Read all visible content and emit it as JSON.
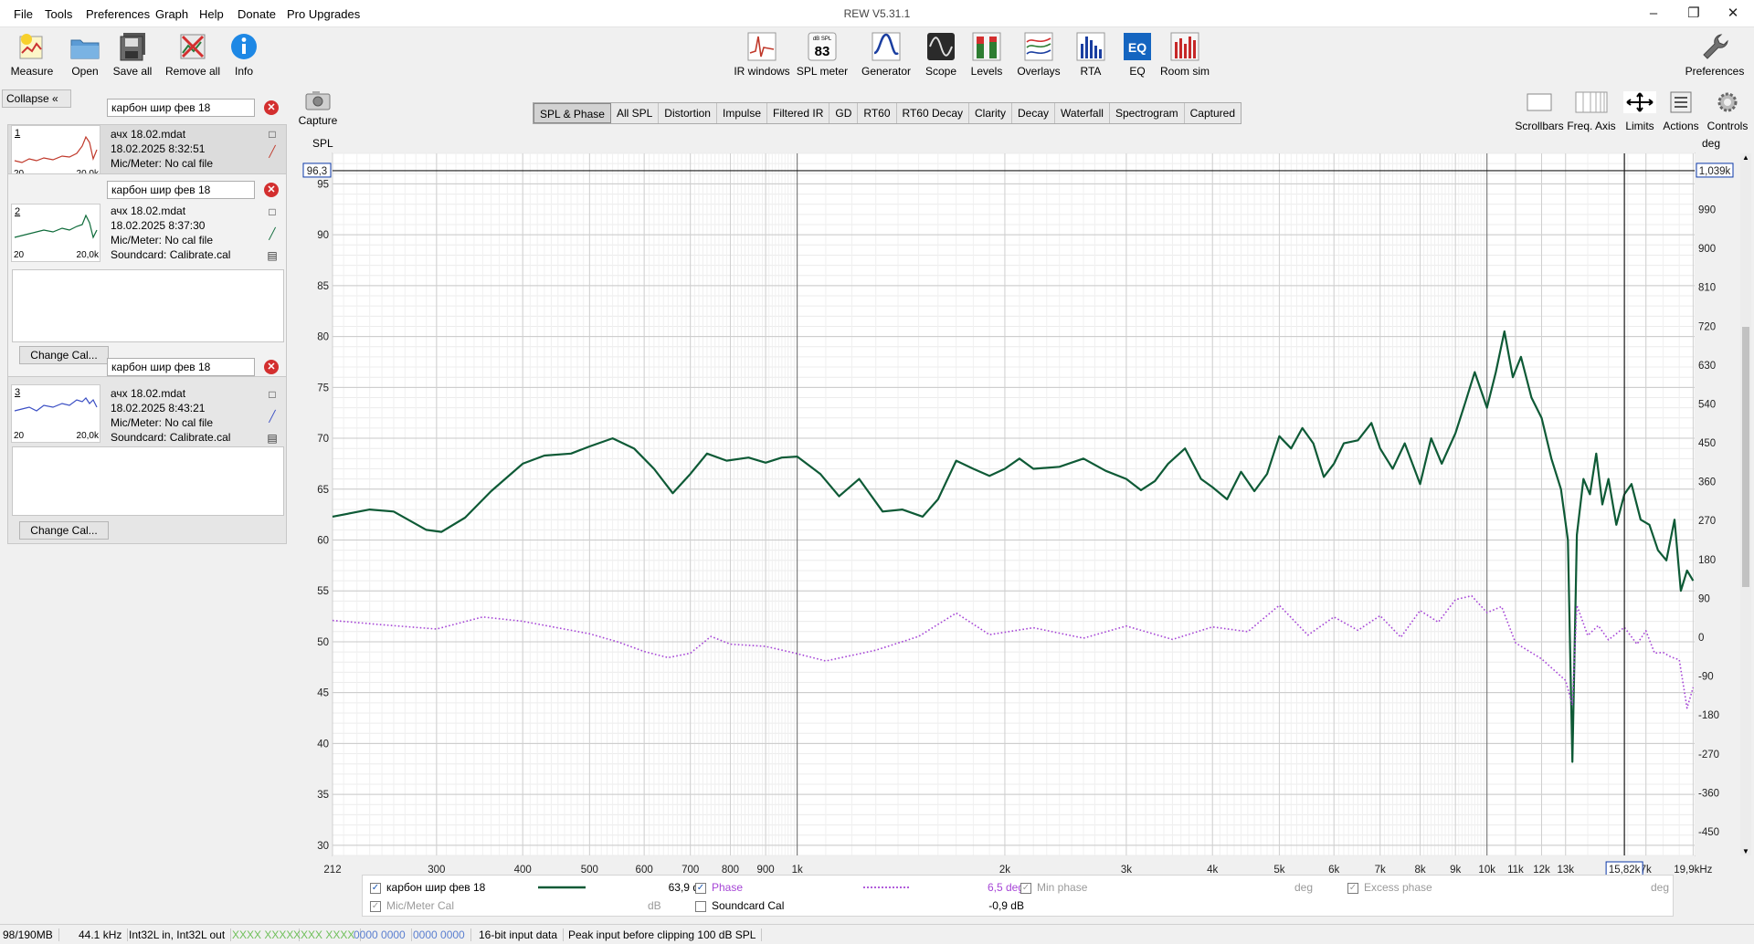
{
  "window": {
    "title": "REW V5.31.1"
  },
  "menu": [
    "File",
    "Tools",
    "Preferences",
    "Graph",
    "Help",
    "Donate",
    "Pro Upgrades"
  ],
  "toolbar_left": [
    "Measure",
    "Open",
    "Save all",
    "Remove all",
    "Info"
  ],
  "toolbar_center": [
    "IR windows",
    "SPL meter",
    "Generator",
    "Scope",
    "Levels",
    "Overlays",
    "RTA",
    "EQ",
    "Room sim"
  ],
  "toolbar_right": {
    "preferences": "Preferences"
  },
  "spl_meter_icon": {
    "unit": "dB SPL",
    "value": "83"
  },
  "left_panel": {
    "collapse_label": "Collapse",
    "change_cal_label": "Change Cal...",
    "measurements": [
      {
        "index": "1",
        "name": "карбон шир фев 18",
        "file": "ачх 18.02.mdat",
        "date": "18.02.2025 8:32:51",
        "mic": "Mic/Meter: No cal file",
        "thumb_lo": "20",
        "thumb_hi": "20,0k",
        "color": "#c0392b"
      },
      {
        "index": "2",
        "name": "карбон шир фев 18",
        "file": "ачх 18.02.mdat",
        "date": "18.02.2025 8:37:30",
        "mic": "Mic/Meter: No cal file",
        "soundcard": "Soundcard: Calibrate.cal",
        "thumb_lo": "20",
        "thumb_hi": "20,0k",
        "color": "#0e6b3a"
      },
      {
        "index": "3",
        "name": "карбон шир фев 18",
        "file": "ачх 18.02.mdat",
        "date": "18.02.2025 8:43:21",
        "mic": "Mic/Meter: No cal file",
        "soundcard": "Soundcard: Calibrate.cal",
        "thumb_lo": "20",
        "thumb_hi": "20,0k",
        "color": "#3b4fc4"
      }
    ]
  },
  "graph": {
    "capture_label": "Capture",
    "tabs": [
      "SPL & Phase",
      "All SPL",
      "Distortion",
      "Impulse",
      "Filtered IR",
      "GD",
      "RT60",
      "RT60 Decay",
      "Clarity",
      "Decay",
      "Waterfall",
      "Spectrogram",
      "Captured"
    ],
    "active_tab": "SPL & Phase",
    "right_controls": [
      "Scrollbars",
      "Freq. Axis",
      "Limits",
      "Actions",
      "Controls"
    ],
    "left_axis_title": "SPL",
    "right_axis_title": "deg",
    "cursor_spl": "96,3",
    "cursor_phase": "1,039k",
    "cursor_freq": "15,82k"
  },
  "chart_data": {
    "type": "line",
    "xlabel": "",
    "ylabel": "SPL",
    "x_scale": "log",
    "xlim": [
      212,
      20000
    ],
    "ylim": [
      29,
      98
    ],
    "y2lim": [
      -505,
      1120
    ],
    "y2label": "deg",
    "x_ticks": [
      212,
      300,
      400,
      500,
      600,
      700,
      800,
      900,
      1000,
      2000,
      3000,
      4000,
      5000,
      6000,
      7000,
      8000,
      9000,
      10000,
      11000,
      12000,
      13000,
      15820,
      17000,
      19900
    ],
    "x_tick_labels": [
      "212",
      "300",
      "400",
      "500",
      "600",
      "700",
      "800",
      "900",
      "1k",
      "2k",
      "3k",
      "4k",
      "5k",
      "6k",
      "7k",
      "8k",
      "9k",
      "10k",
      "11k",
      "12k",
      "13k",
      "15,82k",
      "7k",
      "19,9kHz"
    ],
    "y_ticks": [
      30,
      35,
      40,
      45,
      50,
      55,
      60,
      65,
      70,
      75,
      80,
      85,
      90,
      95
    ],
    "y2_ticks": [
      -450,
      -360,
      -270,
      -180,
      -90,
      0,
      90,
      180,
      270,
      360,
      450,
      540,
      630,
      720,
      810,
      900,
      990,
      1080
    ],
    "y2_tick_labels": [
      "-450",
      "-360",
      "-270",
      "-180",
      "-90",
      "0",
      "90",
      "180",
      "270",
      "360",
      "450",
      "540",
      "630",
      "720",
      "810",
      "900",
      "990",
      "1,08k"
    ],
    "grid": true,
    "cursor": {
      "x": 15820,
      "y": 96.3
    },
    "series": [
      {
        "name": "карбон шир фев 18",
        "color": "#0e5a36",
        "style": "solid",
        "points": [
          [
            212,
            62.3
          ],
          [
            240,
            63.0
          ],
          [
            260,
            62.8
          ],
          [
            290,
            61.0
          ],
          [
            305,
            60.8
          ],
          [
            330,
            62.2
          ],
          [
            360,
            64.8
          ],
          [
            400,
            67.5
          ],
          [
            430,
            68.3
          ],
          [
            470,
            68.5
          ],
          [
            500,
            69.2
          ],
          [
            540,
            70.0
          ],
          [
            580,
            69.0
          ],
          [
            620,
            67.0
          ],
          [
            660,
            64.6
          ],
          [
            700,
            66.5
          ],
          [
            740,
            68.5
          ],
          [
            790,
            67.8
          ],
          [
            850,
            68.1
          ],
          [
            900,
            67.6
          ],
          [
            950,
            68.1
          ],
          [
            1000,
            68.2
          ],
          [
            1080,
            66.5
          ],
          [
            1150,
            64.3
          ],
          [
            1230,
            66.0
          ],
          [
            1330,
            62.8
          ],
          [
            1420,
            63.0
          ],
          [
            1520,
            62.3
          ],
          [
            1600,
            64.0
          ],
          [
            1700,
            67.8
          ],
          [
            1800,
            67.0
          ],
          [
            1900,
            66.3
          ],
          [
            2000,
            67.0
          ],
          [
            2100,
            68.0
          ],
          [
            2200,
            67.0
          ],
          [
            2400,
            67.2
          ],
          [
            2600,
            68.0
          ],
          [
            2800,
            66.8
          ],
          [
            3000,
            66.0
          ],
          [
            3150,
            64.9
          ],
          [
            3300,
            65.8
          ],
          [
            3450,
            67.5
          ],
          [
            3650,
            69.0
          ],
          [
            3850,
            66.0
          ],
          [
            4000,
            65.2
          ],
          [
            4200,
            64.0
          ],
          [
            4400,
            66.7
          ],
          [
            4600,
            64.8
          ],
          [
            4800,
            66.5
          ],
          [
            5000,
            70.2
          ],
          [
            5200,
            69.0
          ],
          [
            5400,
            71.0
          ],
          [
            5600,
            69.5
          ],
          [
            5800,
            66.2
          ],
          [
            6000,
            67.5
          ],
          [
            6200,
            69.5
          ],
          [
            6500,
            69.8
          ],
          [
            6800,
            71.5
          ],
          [
            7000,
            69.0
          ],
          [
            7300,
            67.0
          ],
          [
            7600,
            69.5
          ],
          [
            8000,
            65.5
          ],
          [
            8300,
            70.0
          ],
          [
            8600,
            67.5
          ],
          [
            9000,
            70.5
          ],
          [
            9300,
            73.5
          ],
          [
            9600,
            76.5
          ],
          [
            10000,
            73.0
          ],
          [
            10300,
            76.5
          ],
          [
            10600,
            80.5
          ],
          [
            10900,
            76.0
          ],
          [
            11200,
            78.0
          ],
          [
            11600,
            74.0
          ],
          [
            12000,
            72.0
          ],
          [
            12400,
            68.0
          ],
          [
            12800,
            65.0
          ],
          [
            13100,
            60.0
          ],
          [
            13300,
            38.2
          ],
          [
            13500,
            60.5
          ],
          [
            13800,
            66.0
          ],
          [
            14100,
            64.5
          ],
          [
            14400,
            68.5
          ],
          [
            14700,
            63.5
          ],
          [
            15000,
            66.0
          ],
          [
            15400,
            61.5
          ],
          [
            15820,
            64.5
          ],
          [
            16200,
            65.5
          ],
          [
            16700,
            62.0
          ],
          [
            17200,
            61.5
          ],
          [
            17700,
            59.0
          ],
          [
            18200,
            58.0
          ],
          [
            18700,
            62.0
          ],
          [
            19100,
            55.0
          ],
          [
            19500,
            57.0
          ],
          [
            19900,
            56.0
          ]
        ]
      },
      {
        "name": "Phase",
        "color": "#a646d6",
        "style": "dotted",
        "axis": "right",
        "points": [
          [
            212,
            39
          ],
          [
            250,
            29
          ],
          [
            300,
            19
          ],
          [
            350,
            47
          ],
          [
            400,
            37
          ],
          [
            500,
            8
          ],
          [
            550,
            -11
          ],
          [
            600,
            -33
          ],
          [
            650,
            -47
          ],
          [
            700,
            -37
          ],
          [
            750,
            2
          ],
          [
            800,
            -16
          ],
          [
            900,
            -21
          ],
          [
            1000,
            -38
          ],
          [
            1100,
            -55
          ],
          [
            1300,
            -30
          ],
          [
            1500,
            2
          ],
          [
            1700,
            56
          ],
          [
            1900,
            6
          ],
          [
            2200,
            22
          ],
          [
            2600,
            -2
          ],
          [
            3000,
            26
          ],
          [
            3500,
            -5
          ],
          [
            4000,
            24
          ],
          [
            4500,
            13
          ],
          [
            5000,
            74
          ],
          [
            5500,
            5
          ],
          [
            6000,
            47
          ],
          [
            6500,
            16
          ],
          [
            7000,
            50
          ],
          [
            7500,
            0
          ],
          [
            8000,
            62
          ],
          [
            8500,
            35
          ],
          [
            9000,
            87
          ],
          [
            9500,
            96
          ],
          [
            10000,
            57
          ],
          [
            10500,
            71
          ],
          [
            11000,
            -13
          ],
          [
            12000,
            -50
          ],
          [
            13000,
            -100
          ],
          [
            13300,
            -157
          ],
          [
            13500,
            74
          ],
          [
            14000,
            4
          ],
          [
            14500,
            27
          ],
          [
            15000,
            -6
          ],
          [
            15820,
            23
          ],
          [
            16500,
            -16
          ],
          [
            17000,
            15
          ],
          [
            17500,
            -37
          ],
          [
            18000,
            -35
          ],
          [
            18500,
            -46
          ],
          [
            19000,
            -52
          ],
          [
            19500,
            -164
          ],
          [
            19900,
            -116
          ]
        ]
      }
    ]
  },
  "legend": {
    "row1": {
      "name": "карбон шир фев 18",
      "spl_value": "63,9 dB",
      "phase_label": "Phase",
      "phase_value": "6,5 deg",
      "min_phase_label": "Min phase",
      "min_phase_unit": "deg",
      "excess_phase_label": "Excess phase",
      "excess_phase_unit": "deg"
    },
    "row2": {
      "mic_cal_label": "Mic/Meter Cal",
      "mic_cal_unit": "dB",
      "soundcard_cal_label": "Soundcard Cal",
      "soundcard_cal_value": "-0,9 dB"
    }
  },
  "status_bar": {
    "memory": "98/190MB",
    "rate": "44.1 kHz",
    "format": "Int32L in, Int32L out",
    "levels_a": "XXXX XXXX",
    "levels_b": "XXXX XXXX",
    "hex_a": "0000 0000",
    "hex_b": "0000 0000",
    "bits": "16-bit input data",
    "peak": "Peak input before clipping 100 dB SPL"
  },
  "colors": {
    "spl_trace": "#0e5a36",
    "phase_trace": "#a646d6",
    "cursor_box": "#0b37a8",
    "remove_x": "#d32f2f"
  }
}
